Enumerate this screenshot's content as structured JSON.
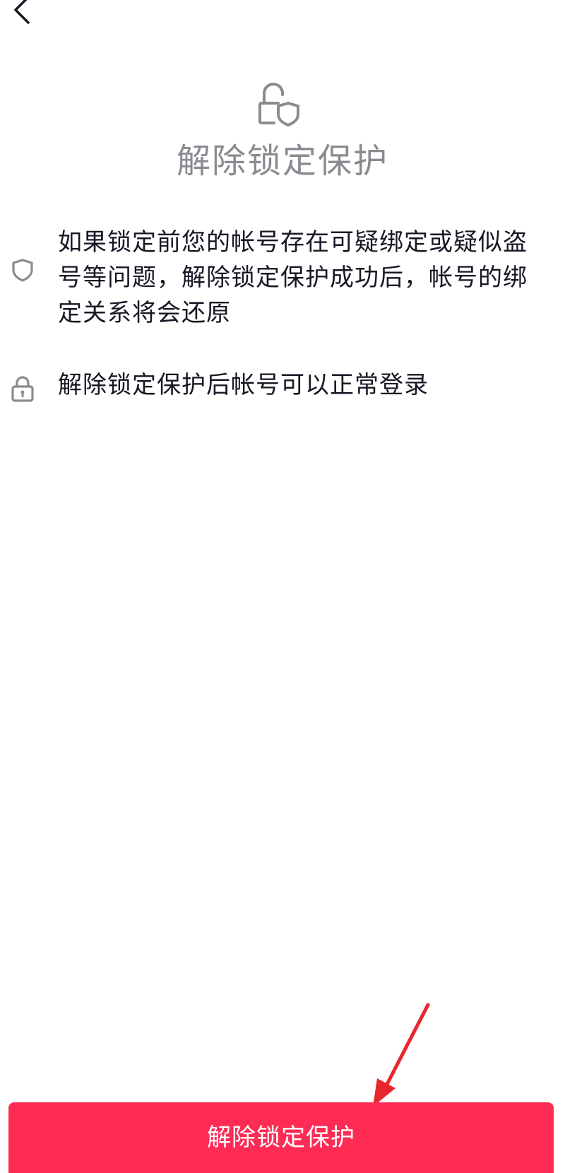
{
  "header": {
    "back_icon": "chevron-left-icon"
  },
  "hero": {
    "icon": "lock-shield-icon",
    "title": "解除锁定保护"
  },
  "info_items": [
    {
      "icon": "shield-icon",
      "text": "如果锁定前您的帐号存在可疑绑定或疑似盗号等问题，解除锁定保护成功后，帐号的绑定关系将会还原"
    },
    {
      "icon": "lock-icon",
      "text": "解除锁定保护后帐号可以正常登录"
    }
  ],
  "footer": {
    "button_label": "解除锁定保护"
  },
  "colors": {
    "accent": "#fe2c55",
    "title_gray": "#8a8b91",
    "text": "#161823",
    "icon_gray": "#8a8b91",
    "annotation_red": "#e8262e"
  }
}
